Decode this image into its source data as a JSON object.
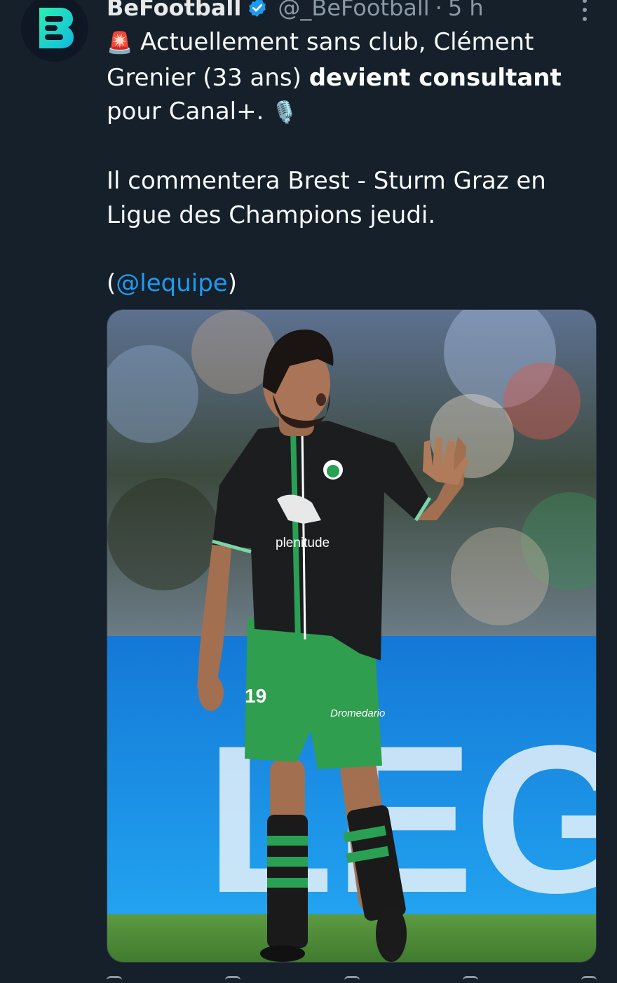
{
  "tweet": {
    "display_name": "BeFootball",
    "handle": "@_BeFootball",
    "separator": "·",
    "time": "5 h",
    "line1_emoji": "🚨",
    "line1_text": " Actuellement sans club, Clément Grenier (33 ans) ",
    "line1_bold": "devient consultant",
    "line1_after": " pour Canal+. ",
    "line1_emoji_end": "🎙️",
    "line2": "Il commentera Brest - Sturm Graz en Ligue des Champions jeudi.",
    "source_open": "(",
    "source_mention": "@lequipe",
    "source_close": ")"
  },
  "media": {
    "shirt_sponsor": "plenitude",
    "board_text": "LEGA",
    "shorts_number": "19",
    "shorts_sponsor": "Dromedario"
  },
  "colors": {
    "background": "#15202b",
    "accent": "#1d9bf0",
    "secondary_text": "#8b98a5",
    "brand": "#19d6c1"
  },
  "icons": {
    "avatar": "befootball-logo-icon",
    "verified": "verified-badge-icon",
    "more": "more-options-icon"
  }
}
